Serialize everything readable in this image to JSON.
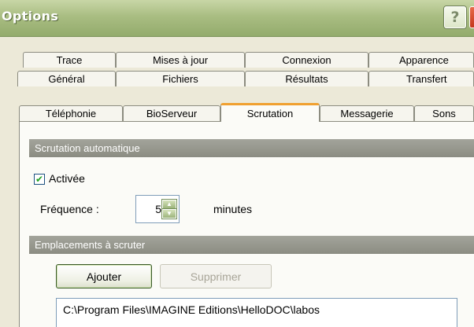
{
  "window": {
    "title": "Options",
    "help_glyph": "?"
  },
  "tabs": {
    "row1": [
      "Trace",
      "Mises à jour",
      "Connexion",
      "Apparence"
    ],
    "row2": [
      "Général",
      "Fichiers",
      "Résultats",
      "Transfert"
    ],
    "row3": [
      "Téléphonie",
      "BioServeur",
      "Scrutation",
      "Messagerie",
      "Sons"
    ],
    "active": "Scrutation"
  },
  "auto_scan": {
    "section_title": "Scrutation automatique",
    "enabled_label": "Activée",
    "enabled": true,
    "frequency_label": "Fréquence :",
    "frequency_value": "5",
    "frequency_unit": "minutes"
  },
  "locations": {
    "section_title": "Emplacements à scruter",
    "add_label": "Ajouter",
    "remove_label": "Supprimer",
    "remove_enabled": false,
    "paths": [
      "C:\\Program Files\\IMAGINE Editions\\HelloDOC\\labos"
    ]
  },
  "colors": {
    "title_bar": "#a9bd82",
    "active_tab_accent": "#f0a030",
    "group_header": "#8b8c82",
    "dialog_bg": "#ece9d8"
  },
  "icons": {
    "help": "help-icon",
    "checkbox": "checkmark-icon",
    "spin_up": "arrow-up-icon",
    "spin_down": "arrow-down-icon"
  }
}
